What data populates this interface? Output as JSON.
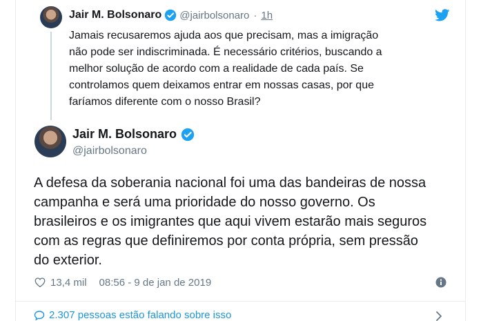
{
  "parent_tweet": {
    "name": "Jair M. Bolsonaro",
    "handle": "@jairbolsonaro",
    "separator": "·",
    "time": "1h",
    "text": "Jamais recusaremos ajuda aos que precisam, mas a imigração\nnão pode ser indiscriminada. É necessário critérios, buscando a\nmelhor solução de acordo com a realidade de cada país. Se\ncontrolamos quem deixamos entrar em nossas casas, por que\nfaríamos diferente com o nosso Brasil?"
  },
  "main_tweet": {
    "name": "Jair M. Bolsonaro",
    "handle": "@jairbolsonaro",
    "text": "A defesa da soberania nacional foi uma das bandeiras de nossa\ncampanha e será uma prioridade do nosso governo. Os\nbrasileiros e os imigrantes que aqui vivem estarão mais seguros\ncom as regras que definiremos por conta própria, sem pressão\ndo exterior.",
    "likes": "13,4 mil",
    "timestamp": "08:56 - 9 de jan de 2019"
  },
  "conversation": {
    "label": "2.307 pessoas estão falando sobre isso"
  },
  "icons": {
    "bird": "twitter-bird-icon",
    "verified": "verified-badge-icon",
    "heart": "heart-icon",
    "info": "info-icon",
    "bubble": "speech-bubble-icon",
    "chevron": "chevron-right-icon"
  },
  "colors": {
    "brand_blue": "#1da1f2",
    "link_blue": "#1b95e0",
    "secondary_text": "#657786",
    "border": "#e6ecf0"
  }
}
